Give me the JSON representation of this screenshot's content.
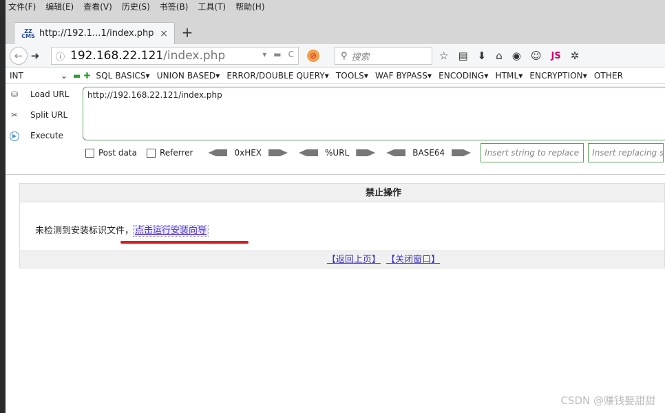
{
  "menubar": {
    "items": [
      "文件(F)",
      "编辑(E)",
      "查看(V)",
      "历史(S)",
      "书签(B)",
      "工具(T)",
      "帮助(H)"
    ]
  },
  "tab": {
    "favicon_text": "ZZ CMS",
    "title": "http://192.1...1/index.php",
    "close": "×",
    "new_tab": "+"
  },
  "navbar": {
    "url_host": "192.168.22.121",
    "url_path": "/index.php",
    "search_placeholder": "搜索",
    "info_icon": "ⓘ",
    "reload_icon": "C",
    "js_label": "JS"
  },
  "hackbar": {
    "select_value": "INT",
    "menus": [
      "SQL BASICS▾",
      "UNION BASED▾",
      "ERROR/DOUBLE QUERY▾",
      "TOOLS▾",
      "WAF BYPASS▾",
      "ENCODING▾",
      "HTML▾",
      "ENCRYPTION▾",
      "OTHER"
    ],
    "actions": [
      "Load URL",
      "Split URL",
      "Execute"
    ],
    "url_value": "http://192.168.22.121/index.php",
    "options": {
      "post_data": "Post data",
      "referrer": "Referrer",
      "hex": "0xHEX",
      "url": "%URL",
      "base64": "BASE64"
    },
    "replace_placeholder": "Insert string to replace",
    "replacing_placeholder": "Insert replacing string"
  },
  "page": {
    "panel_title": "禁止操作",
    "message": "未检测到安装标识文件，",
    "install_link": "点击运行安装向导",
    "back_link": "【返回上页】",
    "close_link": "【关闭窗口】"
  },
  "watermark": "CSDN @赚钱娶甜甜",
  "colors": {
    "accent_green": "#5aa05a",
    "link_purple": "#5533cc",
    "annotation_red": "#d81e1e"
  }
}
